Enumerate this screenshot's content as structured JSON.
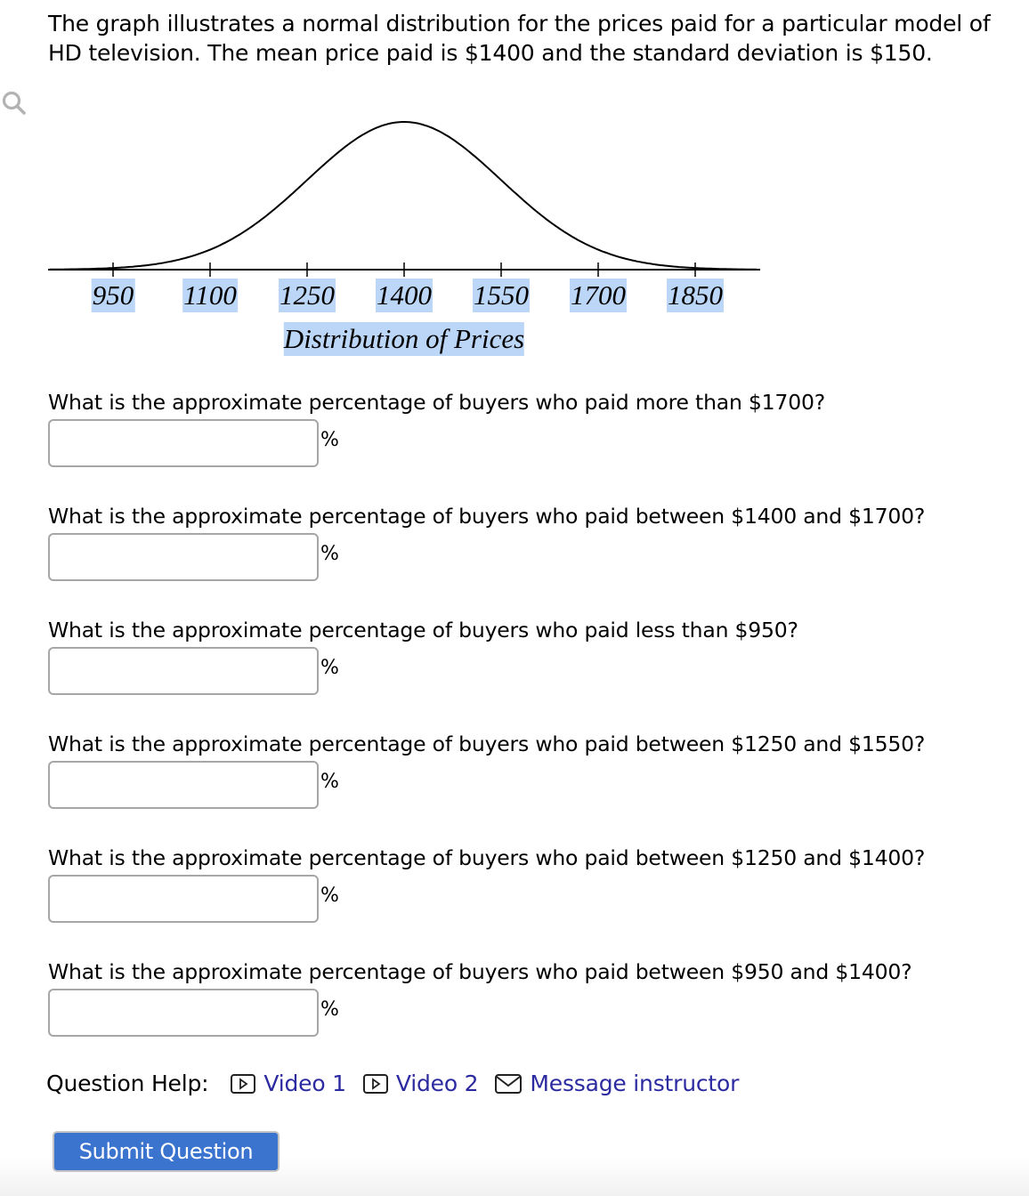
{
  "intro": {
    "text": "The graph illustrates a normal distribution for the prices paid for a particular model of HD television. The mean price paid is $1400 and the standard deviation is $150."
  },
  "chart_data": {
    "type": "line",
    "title": "",
    "distribution": "normal",
    "mean": 1400,
    "std_dev": 150,
    "xlabel": "Distribution of Prices",
    "ylabel": "",
    "x_ticks": [
      950,
      1100,
      1250,
      1400,
      1550,
      1700,
      1850
    ],
    "x_tick_labels": [
      "950",
      "1100",
      "1250",
      "1400",
      "1550",
      "1700",
      "1850"
    ],
    "xlim": [
      850,
      1950
    ],
    "grid": false,
    "legend": "none"
  },
  "icons": {
    "zoom": "magnifier-icon",
    "video": "play-square-icon",
    "message": "envelope-icon"
  },
  "questions": [
    {
      "text": "What is the approximate percentage of buyers who paid more than $1700?",
      "value": "",
      "unit": "%"
    },
    {
      "text": "What is the approximate percentage of buyers who paid between $1400 and $1700?",
      "value": "",
      "unit": "%"
    },
    {
      "text": "What is the approximate percentage of buyers who paid less than $950?",
      "value": "",
      "unit": "%"
    },
    {
      "text": "What is the approximate percentage of buyers who paid between $1250 and $1550?",
      "value": "",
      "unit": "%"
    },
    {
      "text": "What is the approximate percentage of buyers who paid between $1250 and $1400?",
      "value": "",
      "unit": "%"
    },
    {
      "text": "What is the approximate percentage of buyers who paid between $950 and $1400?",
      "value": "",
      "unit": "%"
    }
  ],
  "help": {
    "label": "Question Help:",
    "links": [
      {
        "label": "Video 1",
        "icon": "play-square-icon"
      },
      {
        "label": "Video 2",
        "icon": "play-square-icon"
      },
      {
        "label": "Message instructor",
        "icon": "envelope-icon"
      }
    ]
  },
  "submit": {
    "label": "Submit Question"
  },
  "colors": {
    "link": "#2c2aa0",
    "button": "#3b74cf",
    "label_highlight": "#bcd6f8"
  }
}
